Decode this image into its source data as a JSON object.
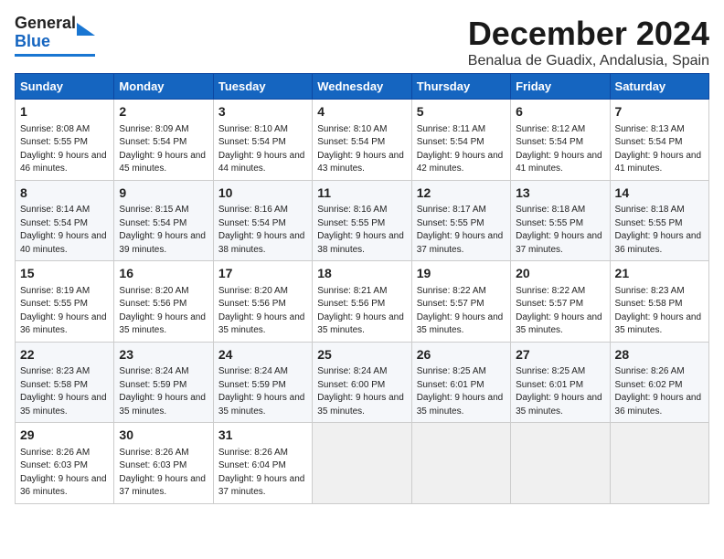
{
  "header": {
    "logo_general": "General",
    "logo_blue": "Blue",
    "month_year": "December 2024",
    "location": "Benalua de Guadix, Andalusia, Spain"
  },
  "days_of_week": [
    "Sunday",
    "Monday",
    "Tuesday",
    "Wednesday",
    "Thursday",
    "Friday",
    "Saturday"
  ],
  "weeks": [
    [
      {
        "day": "1",
        "sunrise": "Sunrise: 8:08 AM",
        "sunset": "Sunset: 5:55 PM",
        "daylight": "Daylight: 9 hours and 46 minutes."
      },
      {
        "day": "2",
        "sunrise": "Sunrise: 8:09 AM",
        "sunset": "Sunset: 5:54 PM",
        "daylight": "Daylight: 9 hours and 45 minutes."
      },
      {
        "day": "3",
        "sunrise": "Sunrise: 8:10 AM",
        "sunset": "Sunset: 5:54 PM",
        "daylight": "Daylight: 9 hours and 44 minutes."
      },
      {
        "day": "4",
        "sunrise": "Sunrise: 8:10 AM",
        "sunset": "Sunset: 5:54 PM",
        "daylight": "Daylight: 9 hours and 43 minutes."
      },
      {
        "day": "5",
        "sunrise": "Sunrise: 8:11 AM",
        "sunset": "Sunset: 5:54 PM",
        "daylight": "Daylight: 9 hours and 42 minutes."
      },
      {
        "day": "6",
        "sunrise": "Sunrise: 8:12 AM",
        "sunset": "Sunset: 5:54 PM",
        "daylight": "Daylight: 9 hours and 41 minutes."
      },
      {
        "day": "7",
        "sunrise": "Sunrise: 8:13 AM",
        "sunset": "Sunset: 5:54 PM",
        "daylight": "Daylight: 9 hours and 41 minutes."
      }
    ],
    [
      {
        "day": "8",
        "sunrise": "Sunrise: 8:14 AM",
        "sunset": "Sunset: 5:54 PM",
        "daylight": "Daylight: 9 hours and 40 minutes."
      },
      {
        "day": "9",
        "sunrise": "Sunrise: 8:15 AM",
        "sunset": "Sunset: 5:54 PM",
        "daylight": "Daylight: 9 hours and 39 minutes."
      },
      {
        "day": "10",
        "sunrise": "Sunrise: 8:16 AM",
        "sunset": "Sunset: 5:54 PM",
        "daylight": "Daylight: 9 hours and 38 minutes."
      },
      {
        "day": "11",
        "sunrise": "Sunrise: 8:16 AM",
        "sunset": "Sunset: 5:55 PM",
        "daylight": "Daylight: 9 hours and 38 minutes."
      },
      {
        "day": "12",
        "sunrise": "Sunrise: 8:17 AM",
        "sunset": "Sunset: 5:55 PM",
        "daylight": "Daylight: 9 hours and 37 minutes."
      },
      {
        "day": "13",
        "sunrise": "Sunrise: 8:18 AM",
        "sunset": "Sunset: 5:55 PM",
        "daylight": "Daylight: 9 hours and 37 minutes."
      },
      {
        "day": "14",
        "sunrise": "Sunrise: 8:18 AM",
        "sunset": "Sunset: 5:55 PM",
        "daylight": "Daylight: 9 hours and 36 minutes."
      }
    ],
    [
      {
        "day": "15",
        "sunrise": "Sunrise: 8:19 AM",
        "sunset": "Sunset: 5:55 PM",
        "daylight": "Daylight: 9 hours and 36 minutes."
      },
      {
        "day": "16",
        "sunrise": "Sunrise: 8:20 AM",
        "sunset": "Sunset: 5:56 PM",
        "daylight": "Daylight: 9 hours and 35 minutes."
      },
      {
        "day": "17",
        "sunrise": "Sunrise: 8:20 AM",
        "sunset": "Sunset: 5:56 PM",
        "daylight": "Daylight: 9 hours and 35 minutes."
      },
      {
        "day": "18",
        "sunrise": "Sunrise: 8:21 AM",
        "sunset": "Sunset: 5:56 PM",
        "daylight": "Daylight: 9 hours and 35 minutes."
      },
      {
        "day": "19",
        "sunrise": "Sunrise: 8:22 AM",
        "sunset": "Sunset: 5:57 PM",
        "daylight": "Daylight: 9 hours and 35 minutes."
      },
      {
        "day": "20",
        "sunrise": "Sunrise: 8:22 AM",
        "sunset": "Sunset: 5:57 PM",
        "daylight": "Daylight: 9 hours and 35 minutes."
      },
      {
        "day": "21",
        "sunrise": "Sunrise: 8:23 AM",
        "sunset": "Sunset: 5:58 PM",
        "daylight": "Daylight: 9 hours and 35 minutes."
      }
    ],
    [
      {
        "day": "22",
        "sunrise": "Sunrise: 8:23 AM",
        "sunset": "Sunset: 5:58 PM",
        "daylight": "Daylight: 9 hours and 35 minutes."
      },
      {
        "day": "23",
        "sunrise": "Sunrise: 8:24 AM",
        "sunset": "Sunset: 5:59 PM",
        "daylight": "Daylight: 9 hours and 35 minutes."
      },
      {
        "day": "24",
        "sunrise": "Sunrise: 8:24 AM",
        "sunset": "Sunset: 5:59 PM",
        "daylight": "Daylight: 9 hours and 35 minutes."
      },
      {
        "day": "25",
        "sunrise": "Sunrise: 8:24 AM",
        "sunset": "Sunset: 6:00 PM",
        "daylight": "Daylight: 9 hours and 35 minutes."
      },
      {
        "day": "26",
        "sunrise": "Sunrise: 8:25 AM",
        "sunset": "Sunset: 6:01 PM",
        "daylight": "Daylight: 9 hours and 35 minutes."
      },
      {
        "day": "27",
        "sunrise": "Sunrise: 8:25 AM",
        "sunset": "Sunset: 6:01 PM",
        "daylight": "Daylight: 9 hours and 35 minutes."
      },
      {
        "day": "28",
        "sunrise": "Sunrise: 8:26 AM",
        "sunset": "Sunset: 6:02 PM",
        "daylight": "Daylight: 9 hours and 36 minutes."
      }
    ],
    [
      {
        "day": "29",
        "sunrise": "Sunrise: 8:26 AM",
        "sunset": "Sunset: 6:03 PM",
        "daylight": "Daylight: 9 hours and 36 minutes."
      },
      {
        "day": "30",
        "sunrise": "Sunrise: 8:26 AM",
        "sunset": "Sunset: 6:03 PM",
        "daylight": "Daylight: 9 hours and 37 minutes."
      },
      {
        "day": "31",
        "sunrise": "Sunrise: 8:26 AM",
        "sunset": "Sunset: 6:04 PM",
        "daylight": "Daylight: 9 hours and 37 minutes."
      },
      null,
      null,
      null,
      null
    ]
  ]
}
